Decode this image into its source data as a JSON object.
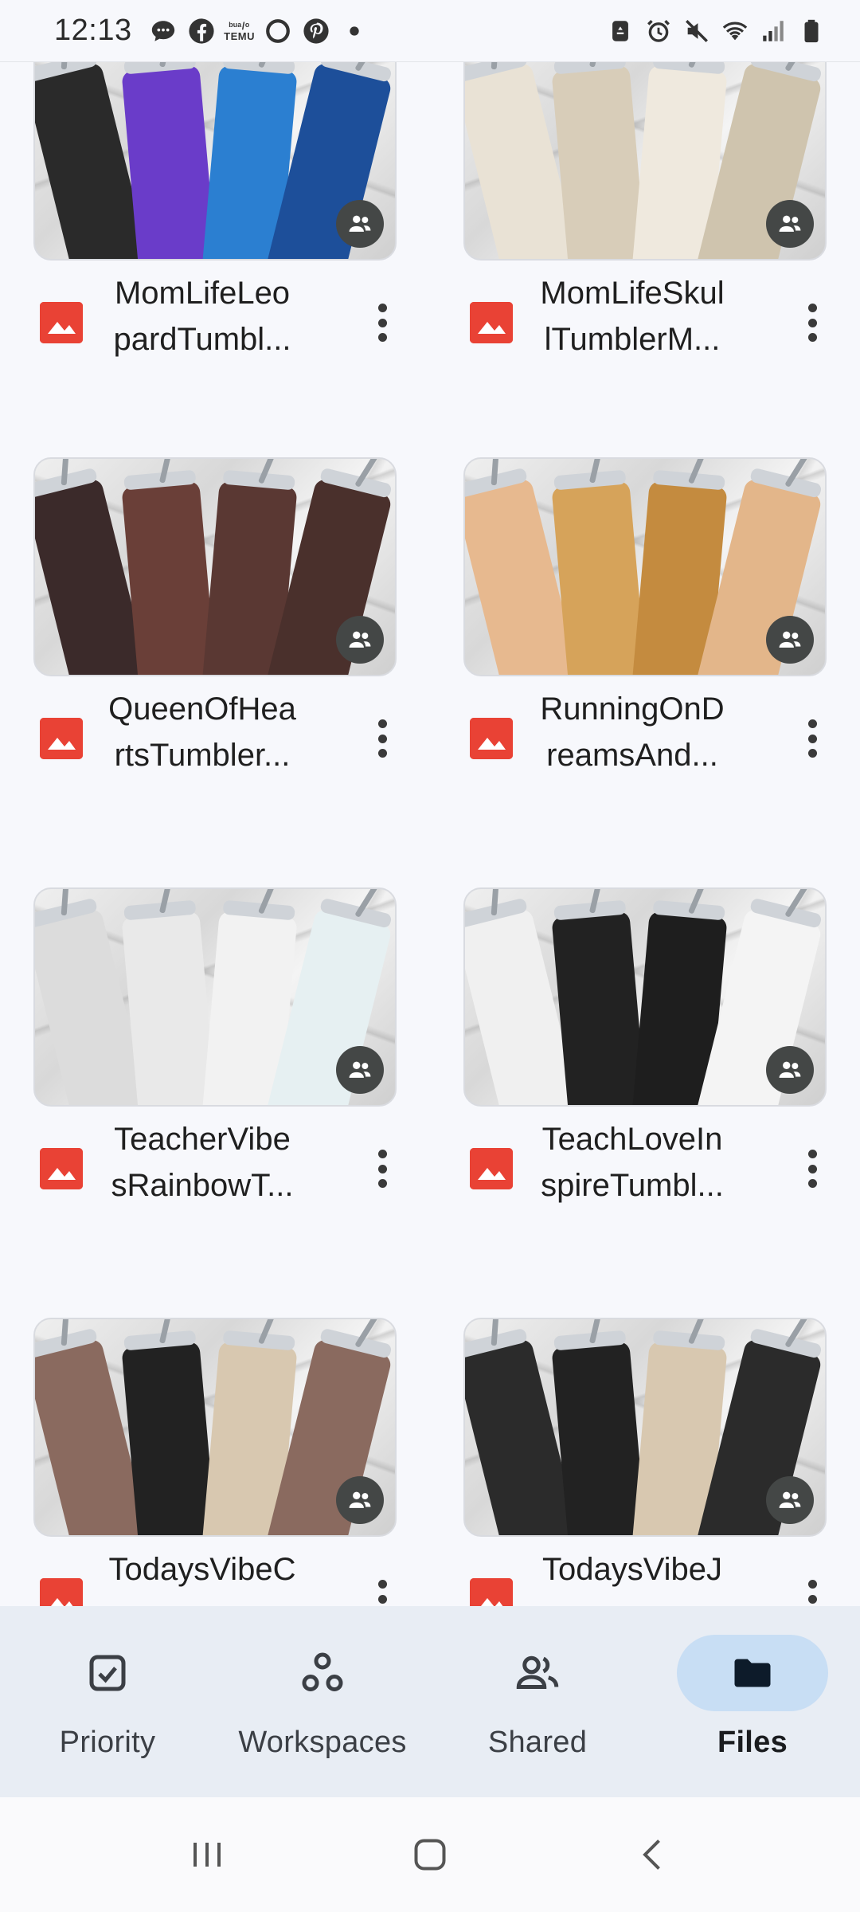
{
  "status_bar": {
    "time": "12:13",
    "left_icons": [
      "chat-icon",
      "facebook-icon",
      "temu-icon",
      "circle-icon",
      "pinterest-icon",
      "dot-icon"
    ],
    "temu_label_top": "ᵇᵘᵃ/ᵒ",
    "temu_label": "TEMU",
    "right_icons": [
      "recycle-icon",
      "alarm-icon",
      "mute-icon",
      "wifi-icon",
      "signal-icon",
      "battery-icon"
    ]
  },
  "files": [
    {
      "name_line1": "MomLifeLeo",
      "name_line2": "pardTumbl...",
      "shared": true,
      "colors": [
        "#2a2a2a",
        "#6a3cc9",
        "#2b7fd1",
        "#1d4f9a",
        "#3a3a3a"
      ]
    },
    {
      "name_line1": "MomLifeSkul",
      "name_line2": "lTumblerM...",
      "shared": true,
      "colors": [
        "#e9e2d5",
        "#d8cdb9",
        "#efe9de",
        "#cfc4ae",
        "#e6dfd2"
      ]
    },
    {
      "name_line1": "QueenOfHea",
      "name_line2": "rtsTumbler...",
      "shared": true,
      "colors": [
        "#3b2a2a",
        "#6a3f38",
        "#5a3833",
        "#4a302c",
        "#3b2a2a"
      ]
    },
    {
      "name_line1": "RunningOnD",
      "name_line2": "reamsAnd...",
      "shared": true,
      "colors": [
        "#e7b98f",
        "#d6a35a",
        "#c48b3f",
        "#e3b68a",
        "#e7b98f"
      ]
    },
    {
      "name_line1": "TeacherVibe",
      "name_line2": "sRainbowT...",
      "shared": true,
      "colors": [
        "#dcdcdc",
        "#e9e9e9",
        "#f2f2f2",
        "#e6f0f2",
        "#2a2a2a"
      ]
    },
    {
      "name_line1": "TeachLoveIn",
      "name_line2": "spireTumbl...",
      "shared": true,
      "colors": [
        "#f0f0f0",
        "#222222",
        "#1e1e1e",
        "#f4f4f4",
        "#2a2a2a"
      ]
    },
    {
      "name_line1": "TodaysVibeC",
      "name_line2": "",
      "shared": true,
      "colors": [
        "#8a6a5f",
        "#222222",
        "#d8c8b0",
        "#8a6a5f",
        "#2a2a2a"
      ]
    },
    {
      "name_line1": "TodaysVibeJ",
      "name_line2": "",
      "shared": true,
      "colors": [
        "#2b2b2b",
        "#222222",
        "#d8c8b0",
        "#2b2b2b",
        "#2a2a2a"
      ]
    }
  ],
  "bottom_nav": {
    "items": [
      {
        "label": "Priority",
        "icon": "priority-check-icon",
        "active": false
      },
      {
        "label": "Workspaces",
        "icon": "workspaces-icon",
        "active": false
      },
      {
        "label": "Shared",
        "icon": "shared-people-icon",
        "active": false
      },
      {
        "label": "Files",
        "icon": "folder-icon",
        "active": true
      }
    ]
  },
  "system_nav": [
    "recents-icon",
    "home-icon",
    "back-icon"
  ],
  "colors": {
    "accent_active": "#c8def4",
    "image_icon": "#e94235",
    "background": "#f7f8fc",
    "nav_background": "#e8edf4"
  }
}
